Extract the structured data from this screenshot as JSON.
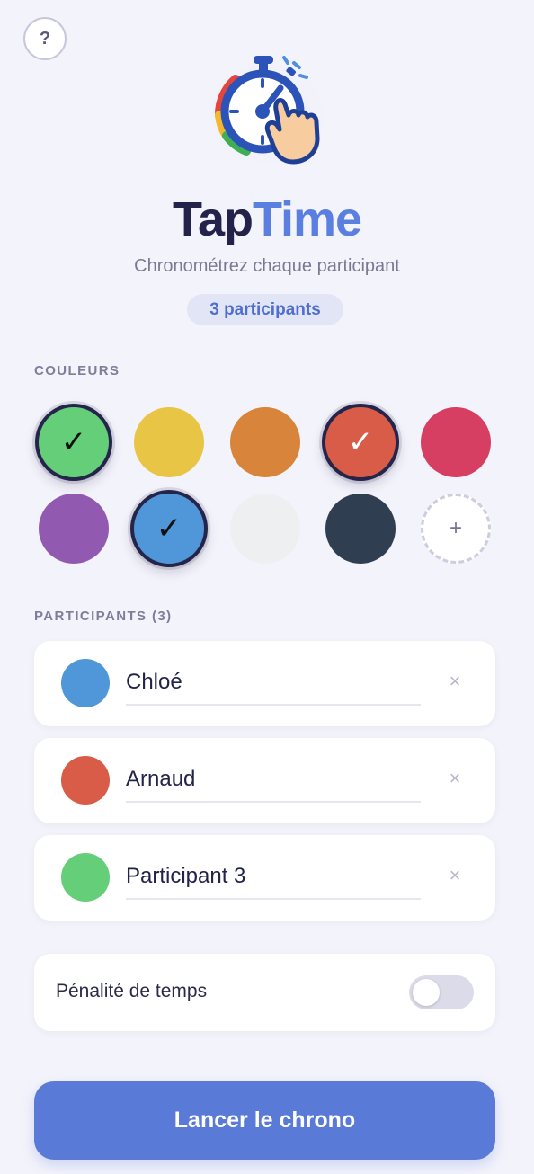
{
  "help": {
    "icon": "question-mark-icon",
    "label": "?"
  },
  "logo": {
    "icon": "stopwatch-tap-icon"
  },
  "app": {
    "title_part1": "Tap",
    "title_part2": "Time",
    "subtitle": "Chronométrez chaque participant",
    "participant_count_badge": "3 participants"
  },
  "colors_section": {
    "label": "COULEURS",
    "swatches": [
      {
        "color": "#64cf78",
        "selected": true,
        "check": "✓",
        "check_color": "#111111"
      },
      {
        "color": "#e9c545",
        "selected": false,
        "check": ""
      },
      {
        "color": "#d8843b",
        "selected": false,
        "check": ""
      },
      {
        "color": "#d85c47",
        "selected": true,
        "check": "✓",
        "check_color": "#ffffff"
      },
      {
        "color": "#d63e62",
        "selected": false,
        "check": ""
      },
      {
        "color": "#9159b0",
        "selected": false,
        "check": ""
      },
      {
        "color": "#4f97d8",
        "selected": true,
        "check": "✓",
        "check_color": "#111111"
      },
      {
        "color": "#eeeff1",
        "selected": false,
        "check": ""
      },
      {
        "color": "#2f3e50",
        "selected": false,
        "check": ""
      }
    ],
    "add_label": "+"
  },
  "participants_section": {
    "label": "PARTICIPANTS (3)",
    "items": [
      {
        "name": "Chloé",
        "color": "#4f97d8",
        "remove": "×"
      },
      {
        "name": "Arnaud",
        "color": "#d85c47",
        "remove": "×"
      },
      {
        "name": "Participant 3",
        "color": "#64cf78",
        "remove": "×"
      }
    ]
  },
  "penalty": {
    "label": "Pénalité de temps",
    "enabled": false
  },
  "start_button": {
    "label": "Lancer le chrono"
  }
}
